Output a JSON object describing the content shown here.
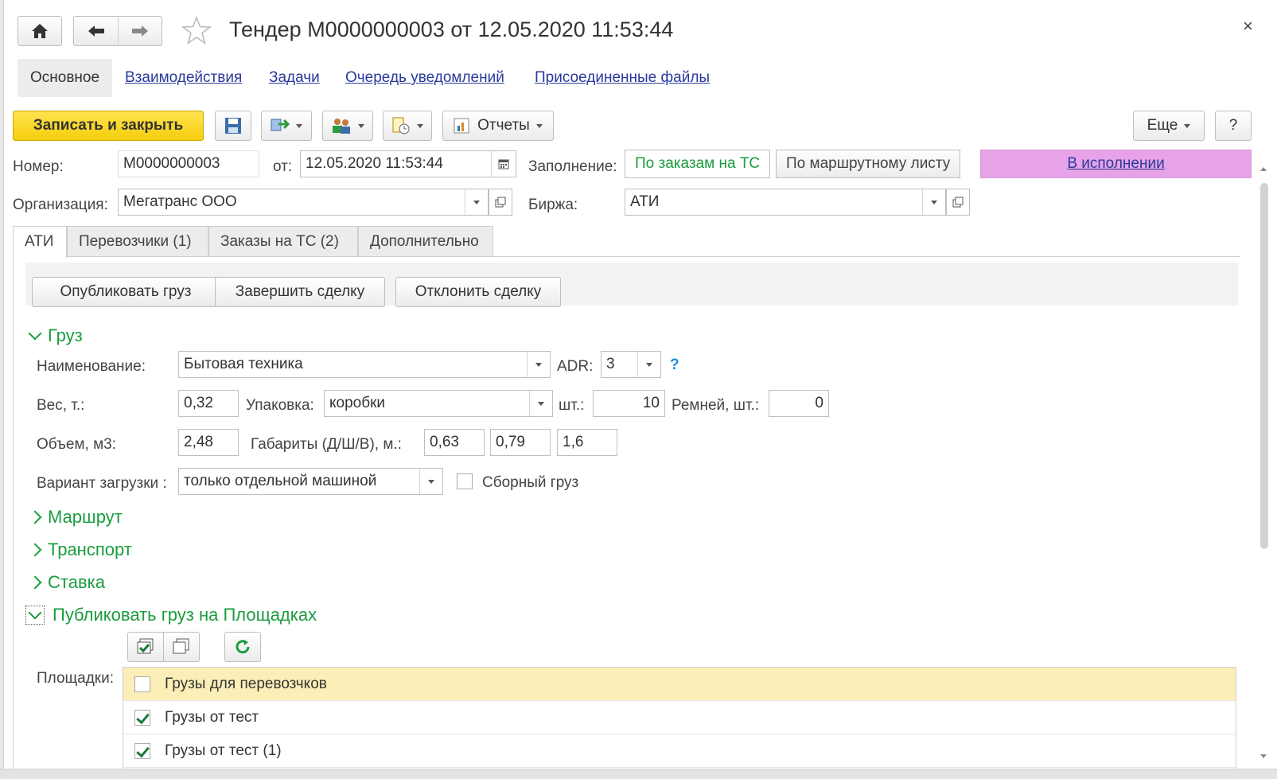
{
  "header": {
    "title": "Тендер М0000000003 от 12.05.2020 11:53:44",
    "close_label": "×"
  },
  "sections": [
    {
      "label": "Основное",
      "active": true
    },
    {
      "label": "Взаимодействия"
    },
    {
      "label": "Задачи"
    },
    {
      "label": "Очередь уведомлений"
    },
    {
      "label": "Присоединенные файлы"
    }
  ],
  "toolbar": {
    "save_close": "Записать и закрыть",
    "reports": "Отчеты",
    "more": "Еще",
    "help": "?"
  },
  "form": {
    "number_label": "Номер:",
    "number_value": "М0000000003",
    "date_label": "от:",
    "date_value": "12.05.2020 11:53:44",
    "fill_label": "Заполнение:",
    "fill_opt1": "По заказам на ТС",
    "fill_opt2": "По маршрутному листу",
    "status": "В исполнении",
    "org_label": "Организация:",
    "org_value": "Мегатранс ООО",
    "exchange_label": "Биржа:",
    "exchange_value": "АТИ"
  },
  "tabs": [
    {
      "label": "АТИ",
      "active": true
    },
    {
      "label": "Перевозчики (1)"
    },
    {
      "label": "Заказы на ТС (2)"
    },
    {
      "label": "Дополнительно"
    }
  ],
  "actions": {
    "publish": "Опубликовать груз",
    "finish": "Завершить сделку",
    "reject": "Отклонить сделку"
  },
  "cargo": {
    "group_title": "Груз",
    "name_label": "Наименование:",
    "name_value": "Бытовая техника",
    "adr_label": "ADR:",
    "adr_value": "3",
    "adr_help": "?",
    "weight_label": "Вес, т.:",
    "weight_value": "0,32",
    "pack_label": "Упаковка:",
    "pack_value": "коробки",
    "pcs_label": "шт.:",
    "pcs_value": "10",
    "belts_label": "Ремней, шт.:",
    "belts_value": "0",
    "volume_label": "Объем,  м3:",
    "volume_value": "2,48",
    "dims_label": "Габариты (Д/Ш/В), м.:",
    "dim_l": "0,63",
    "dim_w": "0,79",
    "dim_h": "1,6",
    "load_label": "Вариант загрузки :",
    "load_value": "только отдельной машиной",
    "combined_label": "Сборный груз",
    "combined_checked": false
  },
  "groups": {
    "route": "Маршрут",
    "transport": "Транспорт",
    "rate": "Ставка",
    "publish": "Публиковать груз на Площадках"
  },
  "platforms": {
    "label": "Площадки:",
    "rows": [
      {
        "name": "Грузы для перевозчков",
        "checked": false,
        "selected": true
      },
      {
        "name": "Грузы от тест",
        "checked": true,
        "selected": false
      },
      {
        "name": "Грузы от тест (1)",
        "checked": true,
        "selected": false
      }
    ]
  },
  "colors": {
    "accent_green": "#1a9c3e",
    "link_blue": "#2a3b9c",
    "primary_yellow": "#f5ce0c",
    "status_bg": "#e8a2e8",
    "selected_row": "#fbeeb6"
  }
}
